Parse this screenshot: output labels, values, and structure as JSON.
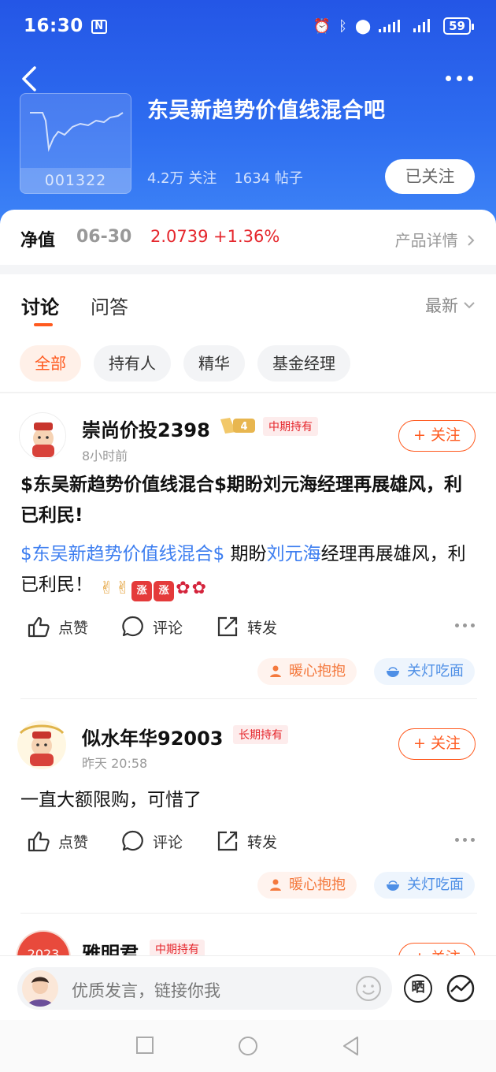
{
  "status_bar": {
    "time": "16:30",
    "nfc_label": "N",
    "battery": "59"
  },
  "header": {
    "title": "东吴新趋势价值线混合吧",
    "fund_code": "001322",
    "followers": "4.2万 关注",
    "posts": "1634 帖子",
    "follow_state": "已关注"
  },
  "nav": {
    "label": "净值",
    "date": "06-30",
    "value": "2.0739",
    "change": "+1.36%",
    "detail_link": "产品详情"
  },
  "tabs": {
    "discuss": "讨论",
    "qa": "问答",
    "sort": "最新"
  },
  "filters": [
    "全部",
    "持有人",
    "精华",
    "基金经理"
  ],
  "posts": [
    {
      "username": "崇尚价投2398",
      "vip_level": "4",
      "hold_tag": "中期持有",
      "time": "8小时前",
      "follow": "+ 关注",
      "title": "$东吴新趋势价值线混合$期盼刘元海经理再展雄风，利已利民!",
      "body_link1": "$东吴新趋势价值线混合$",
      "body_text1": " 期盼",
      "body_link2": "刘元海",
      "body_text2": "经理再展雄风，利已利民！",
      "emoji_rise": "涨",
      "actions": {
        "like": "点赞",
        "comment": "评论",
        "share": "转发"
      },
      "reactions": {
        "warm": "暖心抱抱",
        "light": "关灯吃面"
      }
    },
    {
      "username": "似水年华92003",
      "hold_tag": "长期持有",
      "time": "昨天 20:58",
      "follow": "+ 关注",
      "body": "一直大额限购，可惜了",
      "actions": {
        "like": "点赞",
        "comment": "评论",
        "share": "转发"
      },
      "reactions": {
        "warm": "暖心抱抱",
        "light": "关灯吃面"
      }
    },
    {
      "username": "雅明君",
      "hold_tag": "中期持有",
      "follow": "+ 关注"
    }
  ],
  "compose": {
    "placeholder": "优质发言，链接你我",
    "shai_label": "晒"
  },
  "colors": {
    "brand_blue": "#2e6df0",
    "accent_orange": "#ff5a1f",
    "price_red": "#e5262c",
    "link_blue": "#3d7ef0"
  },
  "icons": [
    "back-arrow-icon",
    "more-icon",
    "chevron-right-icon",
    "chevron-down-icon",
    "like-icon",
    "comment-icon",
    "share-icon",
    "emoji-icon",
    "trend-icon"
  ]
}
